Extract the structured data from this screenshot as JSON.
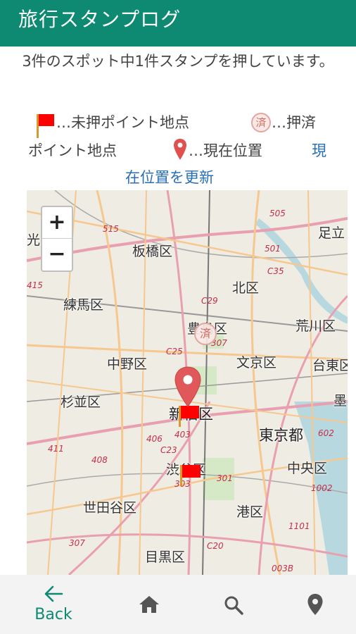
{
  "app": {
    "title": "旅行スタンプログ"
  },
  "status": {
    "message": "3件のスポット中1件スタンプを押しています。"
  },
  "legend": {
    "unstamped_label": "…未押ポイント地点",
    "stamped_icon_text": "済",
    "stamped_label_1": "…押済",
    "stamped_label_2": "ポイント地点",
    "current_label": "…現在位置",
    "refresh_link_1": "現",
    "refresh_link_2": "在位置を更新"
  },
  "map": {
    "zoom_in": "+",
    "zoom_out": "−",
    "stamp_text": "済",
    "labels": {
      "itabashi": "板橋区",
      "kita": "北区",
      "adachi": "足立",
      "nerima": "練馬区",
      "toshima": "豊島区",
      "arakawa": "荒川区",
      "nakano": "中野区",
      "bunkyo": "文京区",
      "taito": "台東区",
      "suginami": "杉並区",
      "shinjuku": "新宿区",
      "sumida": "墨",
      "tokyo": "東京都",
      "shibuya": "渋谷区",
      "chuo": "中央区",
      "setagaya": "世田谷区",
      "minato": "港区",
      "meguro": "目黒区",
      "hikari": "光"
    },
    "roads": {
      "r515": "515",
      "r505": "505",
      "r501": "501",
      "c35": "C35",
      "c29": "C29",
      "r307": "307",
      "c25": "C25",
      "r403": "403",
      "r406": "406",
      "c23": "C23",
      "r411": "411",
      "r408": "408",
      "r303": "303",
      "r301": "301",
      "r602": "602",
      "r1002": "1002",
      "r1101": "1101",
      "c20": "C20",
      "r003b": "003B",
      "r307b": "307",
      "r415": "415"
    }
  },
  "nav": {
    "back_label": "Back",
    "back_icon": "arrow-left-icon",
    "home_icon": "home-icon",
    "search_icon": "search-icon",
    "location_icon": "location-pin-icon"
  },
  "colors": {
    "primary": "#0e8a72",
    "link": "#2a6fb5",
    "flag": "#ff0000"
  }
}
